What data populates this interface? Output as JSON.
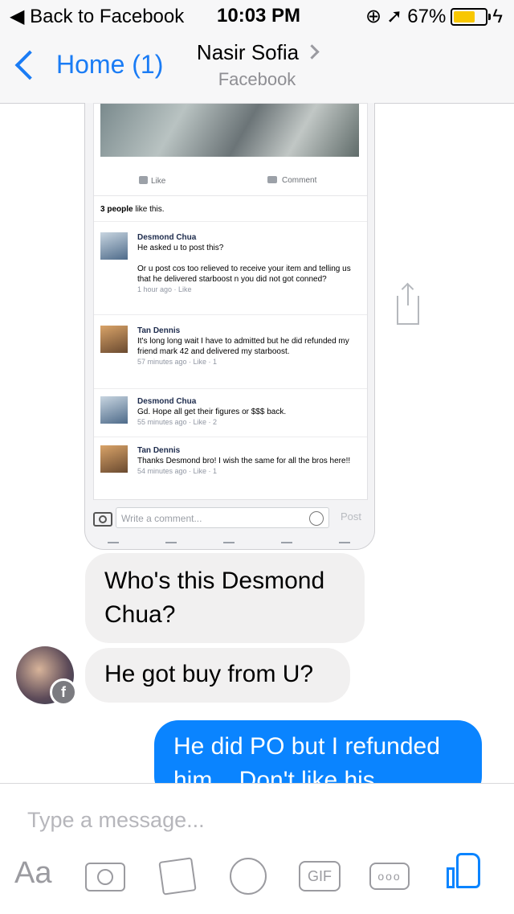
{
  "status": {
    "back": "Back to Facebook",
    "time": "10:03 PM",
    "battery": "67%",
    "battery_level": 0.67
  },
  "nav": {
    "back": "Home (1)",
    "title": "Nasir Sofia",
    "subtitle": "Facebook"
  },
  "shared_post": {
    "like": "Like",
    "comment": "Comment",
    "likes_strong": "3 people",
    "likes_rest": "like this.",
    "comments": [
      {
        "name": "Desmond Chua",
        "lines": [
          "He asked u to post this?",
          "",
          "Or u post cos too relieved to receive your item and telling us that he delivered starboost n you did not got conned?"
        ],
        "meta": "1 hour ago · Like"
      },
      {
        "name": "Tan Dennis",
        "lines": [
          "It's long long wait I have to admitted but he did refunded my friend mark 42 and delivered my starboost."
        ],
        "meta": "57 minutes ago · Like · 1"
      },
      {
        "name": "Desmond Chua",
        "lines": [
          "Gd. Hope all get their figures or $$$ back."
        ],
        "meta": "55 minutes ago · Like · 2"
      },
      {
        "name": "Tan Dennis",
        "lines": [
          "Thanks Desmond bro! I wish the same for all the bros here!!"
        ],
        "meta": "54 minutes ago · Like · 1"
      }
    ],
    "write_placeholder": "Write a comment...",
    "post_button": "Post"
  },
  "messages": [
    {
      "text": "Who's this Desmond Chua?",
      "from": "them"
    },
    {
      "text": "He got buy from U?",
      "from": "them"
    },
    {
      "text": "He did PO but I refunded him... Don't like his",
      "from": "me"
    }
  ],
  "composer": {
    "placeholder": "Type a message...",
    "aa": "Aa",
    "gif": "GIF",
    "more": "ooo",
    "icons": [
      "aa-icon",
      "camera-icon",
      "gallery-icon",
      "emoji-icon",
      "gif-icon",
      "more-icon",
      "thumbs-up-icon"
    ]
  },
  "colors": {
    "accent": "#0a84ff",
    "incoming": "#f1f0f0",
    "battery": "#f8c700"
  }
}
